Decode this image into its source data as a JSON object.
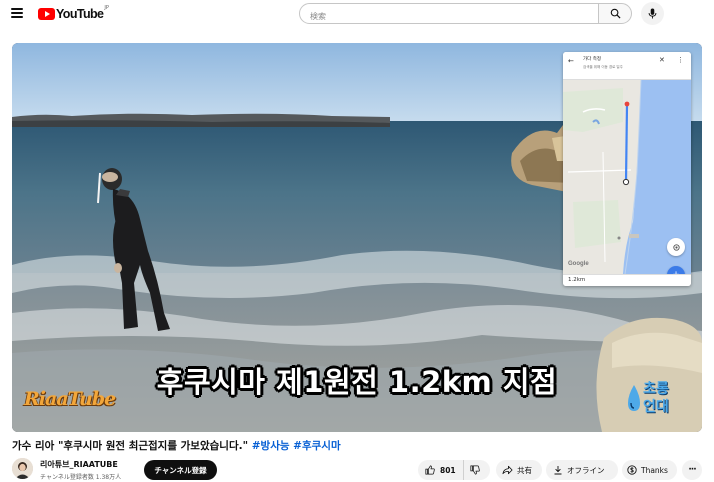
{
  "header": {
    "logo_text": "YouTube",
    "logo_region": "JP",
    "search_placeholder": "検索"
  },
  "video": {
    "caption": "후쿠시마 제1원전 1.2km 지점",
    "brand_left": "RiaaTube",
    "brand_right": [
      "초롱",
      "언대"
    ],
    "map": {
      "title": "가다 측정",
      "subtitle": "검색을 위해 이동 경로 일주",
      "distance": "1.2km",
      "google_label": "Google"
    }
  },
  "title": {
    "text": "가수 리아 \"후쿠시마 원전 최근접지를 가보았습니다.\"",
    "hashtags": "#방사능 #후쿠시마"
  },
  "channel": {
    "name": "리아튜브_RIAATUBE",
    "subscribers": "チャンネル登録者数 1.38万人",
    "subscribe_label": "チャンネル登録"
  },
  "actions": {
    "likes": "801",
    "share": "共有",
    "offline": "オフライン",
    "thanks": "Thanks"
  },
  "colors": {
    "brand_red": "#ff0000",
    "link_blue": "#065fd4",
    "subscribe_bg": "#0f0f0f",
    "pill_bg": "#f2f2f2"
  }
}
